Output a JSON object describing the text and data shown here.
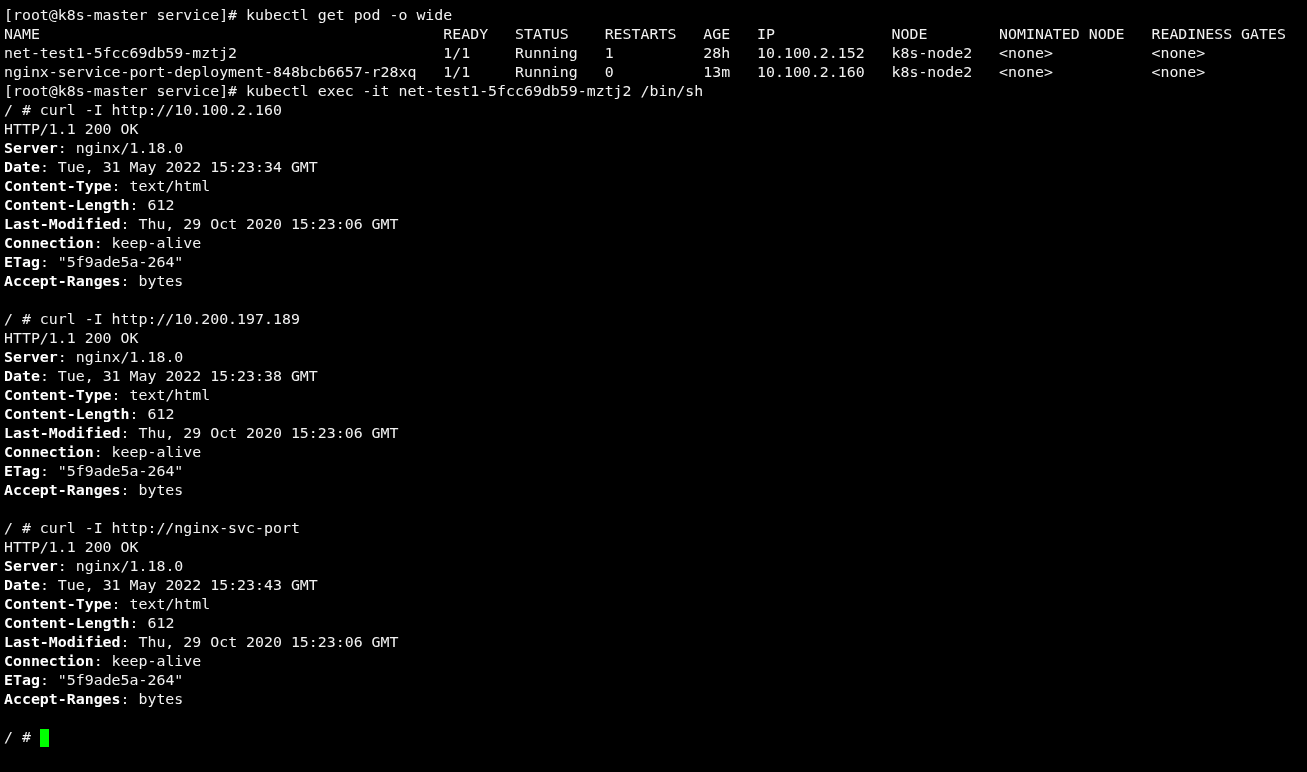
{
  "lines": [
    {
      "kind": "text",
      "text": "[root@k8s-master service]# kubectl get pod -o wide"
    },
    {
      "kind": "table",
      "columns": [
        "NAME",
        "READY",
        "STATUS",
        "RESTARTS",
        "AGE",
        "IP",
        "NODE",
        "NOMINATED NODE",
        "READINESS GATES"
      ],
      "rows": [
        [
          "net-test1-5fcc69db59-mztj2",
          "1/1",
          "Running",
          "1",
          "28h",
          "10.100.2.152",
          "k8s-node2",
          "<none>",
          "<none>"
        ],
        [
          "nginx-service-port-deployment-848bcb6657-r28xq",
          "1/1",
          "Running",
          "0",
          "13m",
          "10.100.2.160",
          "k8s-node2",
          "<none>",
          "<none>"
        ]
      ]
    },
    {
      "kind": "text",
      "text": "[root@k8s-master service]# kubectl exec -it net-test1-5fcc69db59-mztj2 /bin/sh"
    },
    {
      "kind": "text",
      "text": "/ # curl -I http://10.100.2.160"
    },
    {
      "kind": "text",
      "text": "HTTP/1.1 200 OK"
    },
    {
      "kind": "text",
      "text": "**Server**: nginx/1.18.0"
    },
    {
      "kind": "text",
      "text": "**Date**: Tue, 31 May 2022 15:23:34 GMT"
    },
    {
      "kind": "text",
      "text": "**Content-Type**: text/html"
    },
    {
      "kind": "text",
      "text": "**Content-Length**: 612"
    },
    {
      "kind": "text",
      "text": "**Last-Modified**: Thu, 29 Oct 2020 15:23:06 GMT"
    },
    {
      "kind": "text",
      "text": "**Connection**: keep-alive"
    },
    {
      "kind": "text",
      "text": "**ETag**: \"5f9ade5a-264\""
    },
    {
      "kind": "text",
      "text": "**Accept-Ranges**: bytes"
    },
    {
      "kind": "blank"
    },
    {
      "kind": "text",
      "text": "/ # curl -I http://10.200.197.189"
    },
    {
      "kind": "text",
      "text": "HTTP/1.1 200 OK"
    },
    {
      "kind": "text",
      "text": "**Server**: nginx/1.18.0"
    },
    {
      "kind": "text",
      "text": "**Date**: Tue, 31 May 2022 15:23:38 GMT"
    },
    {
      "kind": "text",
      "text": "**Content-Type**: text/html"
    },
    {
      "kind": "text",
      "text": "**Content-Length**: 612"
    },
    {
      "kind": "text",
      "text": "**Last-Modified**: Thu, 29 Oct 2020 15:23:06 GMT"
    },
    {
      "kind": "text",
      "text": "**Connection**: keep-alive"
    },
    {
      "kind": "text",
      "text": "**ETag**: \"5f9ade5a-264\""
    },
    {
      "kind": "text",
      "text": "**Accept-Ranges**: bytes"
    },
    {
      "kind": "blank"
    },
    {
      "kind": "text",
      "text": "/ # curl -I http://nginx-svc-port"
    },
    {
      "kind": "text",
      "text": "HTTP/1.1 200 OK"
    },
    {
      "kind": "text",
      "text": "**Server**: nginx/1.18.0"
    },
    {
      "kind": "text",
      "text": "**Date**: Tue, 31 May 2022 15:23:43 GMT"
    },
    {
      "kind": "text",
      "text": "**Content-Type**: text/html"
    },
    {
      "kind": "text",
      "text": "**Content-Length**: 612"
    },
    {
      "kind": "text",
      "text": "**Last-Modified**: Thu, 29 Oct 2020 15:23:06 GMT"
    },
    {
      "kind": "text",
      "text": "**Connection**: keep-alive"
    },
    {
      "kind": "text",
      "text": "**ETag**: \"5f9ade5a-264\""
    },
    {
      "kind": "text",
      "text": "**Accept-Ranges**: bytes"
    },
    {
      "kind": "blank"
    },
    {
      "kind": "prompt",
      "text": "/ #"
    }
  ]
}
